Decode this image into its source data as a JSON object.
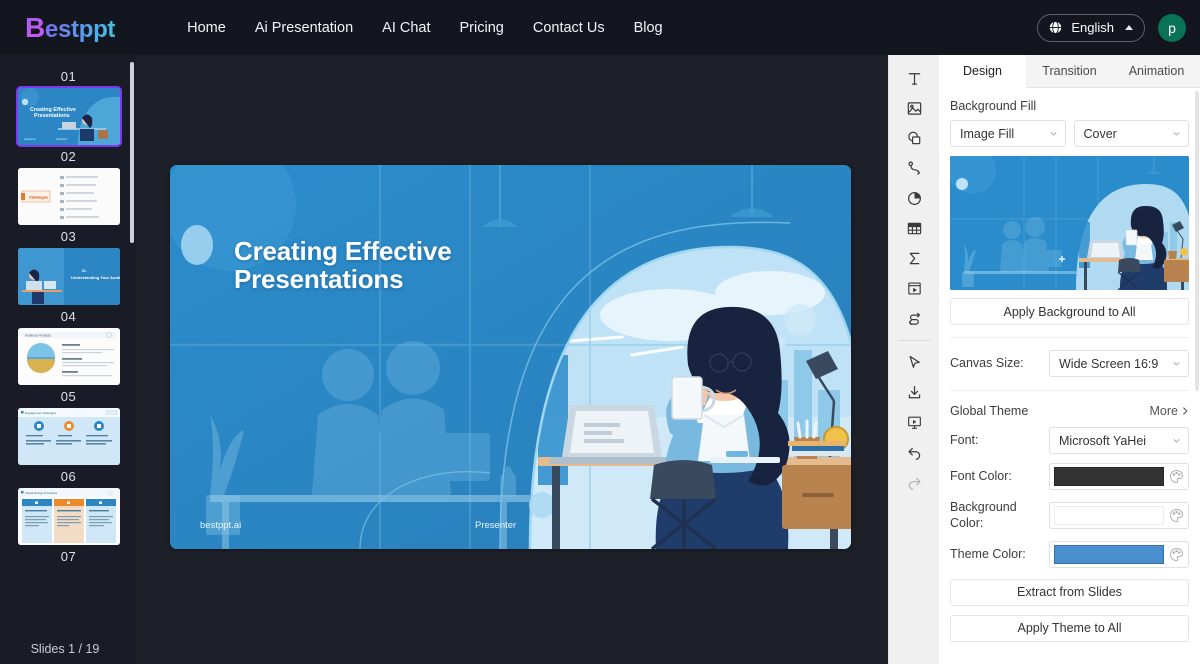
{
  "topbar": {
    "logo_mark": "B",
    "logo_rest": "estppt",
    "nav": [
      {
        "label": "Home"
      },
      {
        "label": "Ai Presentation"
      },
      {
        "label": "AI Chat"
      },
      {
        "label": "Pricing"
      },
      {
        "label": "Contact Us"
      },
      {
        "label": "Blog"
      }
    ],
    "language": "English",
    "language_icon": "globe-icon",
    "language_caret": "caret-up-icon",
    "avatar_initial": "p",
    "avatar_color": "#0a7355"
  },
  "slidelist": {
    "slides": [
      {
        "num": "01",
        "kind": "title-blue",
        "selected": true
      },
      {
        "num": "02",
        "kind": "catalogue-white",
        "selected": false
      },
      {
        "num": "03",
        "kind": "section-blue",
        "selected": false
      },
      {
        "num": "04",
        "kind": "content-white",
        "selected": false
      },
      {
        "num": "05",
        "kind": "three-icons-lightblue",
        "selected": false
      },
      {
        "num": "06",
        "kind": "three-columns",
        "selected": false
      },
      {
        "num": "07",
        "kind": "partial",
        "selected": false
      }
    ],
    "counter": "Slides 1 / 19"
  },
  "canvas": {
    "slide": {
      "title": "Creating Effective Presentations",
      "footer_left": "bestppt.ai",
      "footer_right": "Presenter"
    }
  },
  "toolrail": {
    "tools": [
      {
        "name": "text-icon",
        "title": "Text"
      },
      {
        "name": "image-icon",
        "title": "Image"
      },
      {
        "name": "shape-icon",
        "title": "Shape"
      },
      {
        "name": "connector-icon",
        "title": "Connector"
      },
      {
        "name": "chart-pie-icon",
        "title": "Chart"
      },
      {
        "name": "table-icon",
        "title": "Table"
      },
      {
        "name": "formula-sigma-icon",
        "title": "Formula"
      },
      {
        "name": "media-icon",
        "title": "Media"
      },
      {
        "name": "flow-icon",
        "title": "Flow"
      }
    ],
    "tools2": [
      {
        "name": "cursor-pointer-icon",
        "title": "Select"
      },
      {
        "name": "download-icon",
        "title": "Download"
      },
      {
        "name": "present-icon",
        "title": "Present"
      },
      {
        "name": "undo-icon",
        "title": "Undo"
      },
      {
        "name": "redo-icon",
        "title": "Redo"
      }
    ]
  },
  "rightpanel": {
    "tabs": [
      {
        "label": "Design",
        "active": true
      },
      {
        "label": "Transition",
        "active": false
      },
      {
        "label": "Animation",
        "active": false
      }
    ],
    "background_fill_label": "Background Fill",
    "fill_type": "Image Fill",
    "fill_mode": "Cover",
    "apply_background_label": "Apply Background to All",
    "canvas_size_label": "Canvas Size:",
    "canvas_size_value": "Wide Screen 16:9",
    "global_theme_label": "Global Theme",
    "more_label": "More",
    "font_label": "Font:",
    "font_value": "Microsoft YaHei",
    "font_color_label": "Font Color:",
    "font_color_value": "#333333",
    "background_color_label": "Background Color:",
    "background_color_value": "#ffffff",
    "theme_color_label": "Theme Color:",
    "theme_color_value": "#4a90d0",
    "extract_label": "Extract from Slides",
    "apply_theme_label": "Apply Theme to All"
  }
}
